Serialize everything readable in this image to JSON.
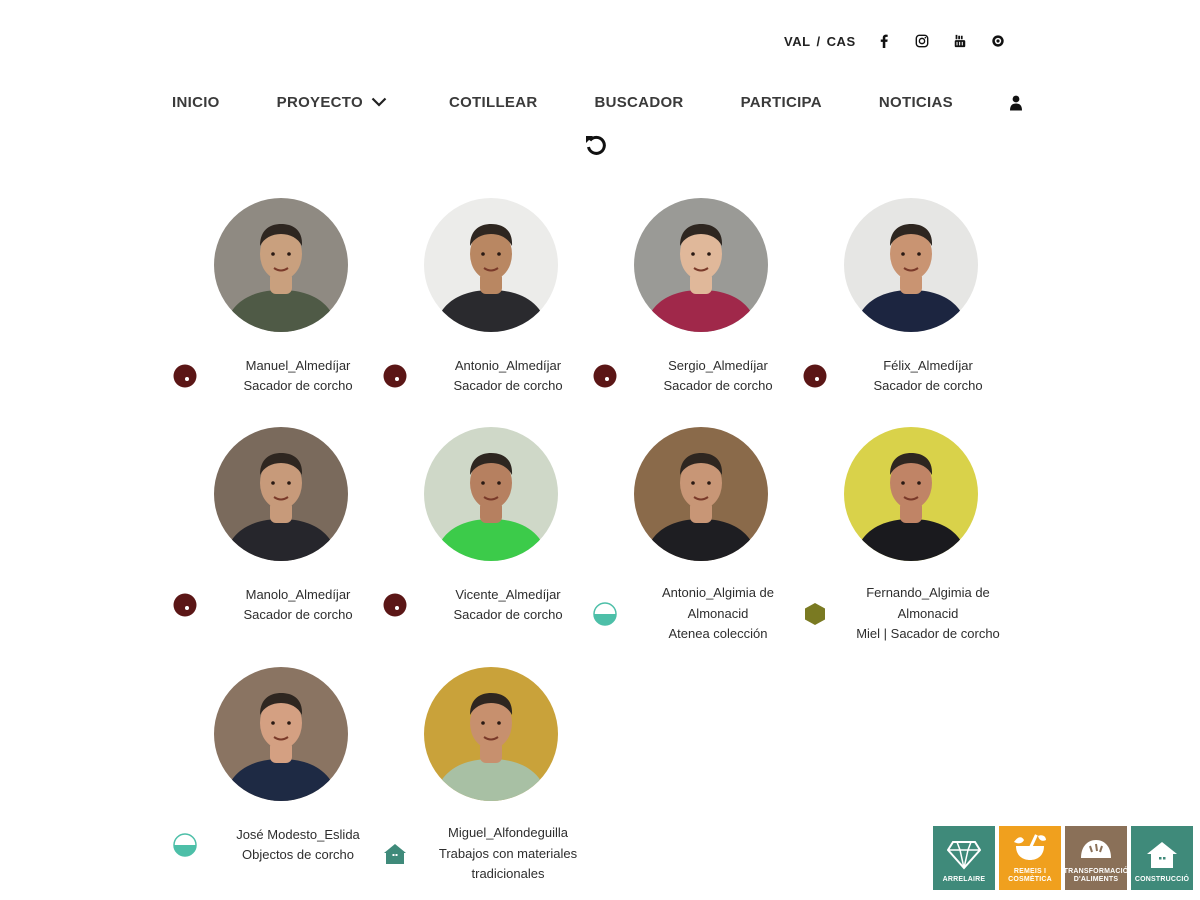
{
  "header": {
    "lang_val": "VAL",
    "lang_sep": "/",
    "lang_cas": "CAS",
    "social_icons": [
      "facebook-icon",
      "instagram-icon",
      "youtube-icon",
      "tripadvisor-icon"
    ]
  },
  "nav": {
    "items": [
      {
        "label": "INICIO"
      },
      {
        "label": "PROYECTO"
      },
      {
        "label": "COTILLEAR"
      },
      {
        "label": "BUSCADOR"
      },
      {
        "label": "PARTICIPA"
      },
      {
        "label": "NOTICIAS"
      }
    ],
    "user_icon": "user-icon",
    "reset_icon": "reset-icon"
  },
  "colors": {
    "dark_red": "#5b1616",
    "teal": "#4dbfa8",
    "olive": "#7a7a22",
    "house_green": "#3f8a7a"
  },
  "people": [
    {
      "name": "Manuel_Almedíjar",
      "role": [
        "Sacador de corcho"
      ],
      "badge": "dot-red",
      "skin": "#c9a07e",
      "bg": "#8f8a82",
      "shirt": "#4f5a46"
    },
    {
      "name": "Antonio_Almedíjar",
      "role": [
        "Sacador de corcho"
      ],
      "badge": "dot-red",
      "skin": "#b98762",
      "bg": "#ececea",
      "shirt": "#2a2a2e"
    },
    {
      "name": "Sergio_Almedíjar",
      "role": [
        "Sacador de corcho"
      ],
      "badge": "dot-red",
      "skin": "#e0b89a",
      "bg": "#9a9a96",
      "shirt": "#a0284a"
    },
    {
      "name": "Félix_Almedíjar",
      "role": [
        "Sacador de corcho"
      ],
      "badge": "dot-red",
      "skin": "#c99472",
      "bg": "#e6e6e4",
      "shirt": "#1c2540"
    },
    {
      "name": "Manolo_Almedíjar",
      "role": [
        "Sacador de corcho"
      ],
      "badge": "dot-red",
      "skin": "#c79a7a",
      "bg": "#7a6a5c",
      "shirt": "#26262c"
    },
    {
      "name": "Vicente_Almedíjar",
      "role": [
        "Sacador de corcho"
      ],
      "badge": "dot-red",
      "skin": "#b68060",
      "bg": "#cfd8c8",
      "shirt": "#3ccb4a"
    },
    {
      "name": "Antonio_Algimia de",
      "name2": "Almonacid",
      "role": [
        "Atenea colección"
      ],
      "badge": "half-teal",
      "skin": "#c89676",
      "bg": "#8a6a4a",
      "shirt": "#1e1e22"
    },
    {
      "name": "Fernando_Algimia de",
      "name2": "Almonacid",
      "role": [
        "Miel | Sacador de corcho"
      ],
      "badge": "hex-olive",
      "skin": "#c08466",
      "bg": "#d9d24a",
      "shirt": "#1a1a1e"
    },
    {
      "name": "José Modesto_Eslida",
      "role": [
        "Objectos de corcho"
      ],
      "badge": "half-teal",
      "skin": "#d4a082",
      "bg": "#8a7462",
      "shirt": "#1e2a44"
    },
    {
      "name": "Miguel_Alfondeguilla",
      "role": [
        "Trabajos con materiales",
        "tradicionales"
      ],
      "badge": "house-green",
      "skin": "#c7906e",
      "bg": "#c9a23a",
      "shirt": "#a8c0a4"
    }
  ],
  "categories": [
    {
      "label": "ARRELAIRE",
      "color": "#3f8a7a",
      "icon": "diamond-icon"
    },
    {
      "label": "REMEIS I COSMÈTICA",
      "color": "#f0a01e",
      "icon": "mortar-icon"
    },
    {
      "label": "TRANSFORMACIÓ D'ALIMENTS",
      "color": "#8a7058",
      "icon": "bread-icon"
    },
    {
      "label": "CONSTRUCCIÓ",
      "color": "#3f8a7a",
      "icon": "house-icon"
    }
  ]
}
